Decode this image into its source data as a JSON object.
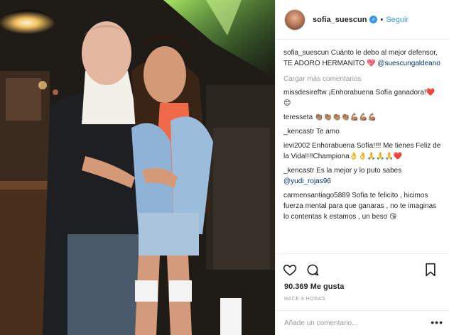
{
  "post": {
    "username": "sofia_suescun",
    "verified": true,
    "separator": "•",
    "follow_label": "Seguir",
    "caption_user": "sofia_suescun",
    "caption_text": "Cuánto le debo al mejor defensor, TE ADORO HERMANITO 💖",
    "caption_mention": "@suescungaldeano",
    "load_more": "Cargar más comentarios",
    "comments": [
      {
        "user": "missdesireftw",
        "text": "¡Enhorabuena Sofía ganadora!❤️😍"
      },
      {
        "user": "teresseta",
        "text": "👏🏽👏🏽👏🏽👏🏽💪🏽💪🏽💪🏽"
      },
      {
        "user": "_kencastr",
        "text": "Te amo"
      },
      {
        "user": "ievi2002",
        "text": "Enhorabuena Sofía!!!! Me tienes Feliz de la Vida!!!!Championa👌👌🙏🙏🙏❤️"
      },
      {
        "user": "_kencastr",
        "text": "Es la mejor y lo puto sabes",
        "mention": "@yudi_rojas96"
      },
      {
        "user": "carmensantiago5889",
        "text": "Sofia te felicito , hicimos fuerza mental para que ganaras , no te imaginas lo contentas k estamos , un beso 😘"
      }
    ],
    "likes": "90.369 Me gusta",
    "time": "HACE 9 HORAS",
    "comment_placeholder": "Añade un comentario...",
    "more_label": "•••"
  },
  "icons": {
    "like": "heart-icon",
    "comment": "comment-icon",
    "save": "bookmark-icon"
  }
}
